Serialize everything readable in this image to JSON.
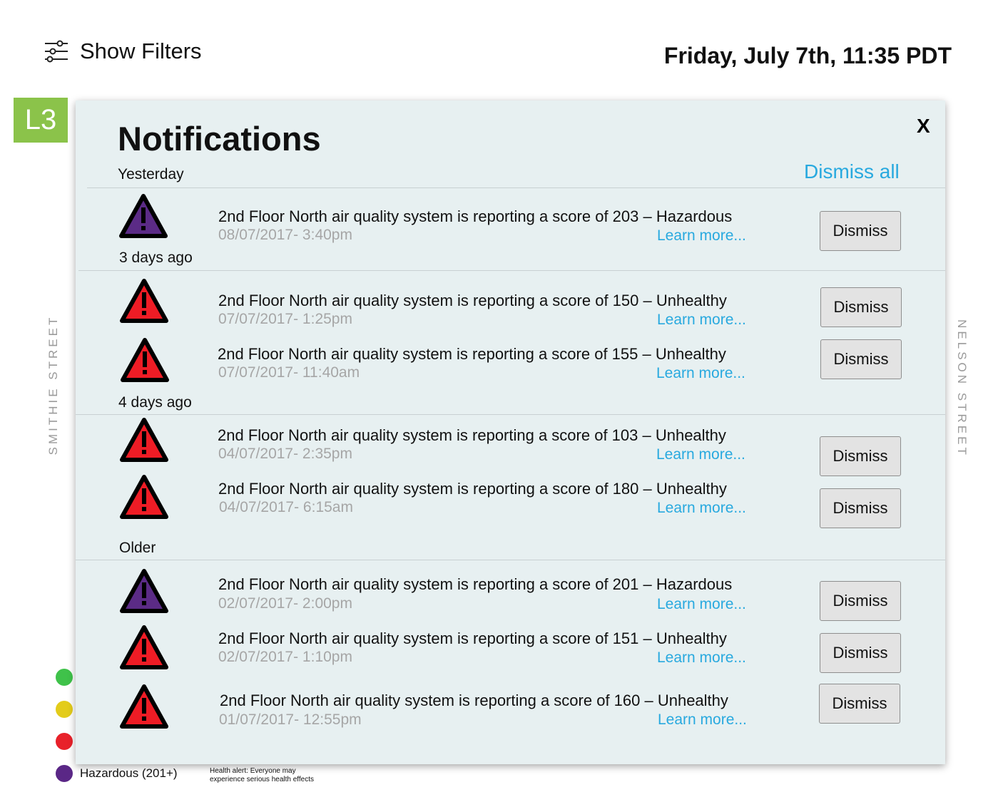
{
  "header": {
    "filters_label": "Show Filters",
    "datetime": "Friday, July 7th, 11:35 PDT"
  },
  "level_badge": "L3",
  "streets": {
    "left": "SMITHIE STREET",
    "right": "NELSON STREET"
  },
  "legend": {
    "colors": [
      "#3fc24a",
      "#e3cc1b",
      "#e8212a",
      "#5a2786"
    ],
    "hazardous_label": "Hazardous (201+)",
    "hazardous_desc": "Health alert: Everyone may experience serious health effects"
  },
  "panel": {
    "title": "Notifications",
    "close_label": "X",
    "dismiss_all_label": "Dismiss all",
    "groups": [
      "Yesterday",
      "3 days ago",
      "4 days ago",
      "Older"
    ],
    "learn_more_label": "Learn more...",
    "dismiss_label": "Dismiss",
    "colors": {
      "hazardous": "#5b2b86",
      "unhealthy": "#ee1c25",
      "link": "#28a9df"
    },
    "items": [
      {
        "message": "2nd Floor North air quality system is reporting a score of 203 – Hazardous",
        "timestamp": "08/07/2017- 3:40pm",
        "severity": "hazardous"
      },
      {
        "message": "2nd Floor North air quality system is reporting a score of 150 – Unhealthy",
        "timestamp": "07/07/2017- 1:25pm",
        "severity": "unhealthy"
      },
      {
        "message": "2nd Floor North air quality system is reporting a score of 155 – Unhealthy",
        "timestamp": "07/07/2017- 11:40am",
        "severity": "unhealthy"
      },
      {
        "message": "2nd Floor North air quality system is reporting a score of 103 – Unhealthy",
        "timestamp": "04/07/2017- 2:35pm",
        "severity": "unhealthy"
      },
      {
        "message": "2nd Floor North air quality system is reporting a score of 180 – Unhealthy",
        "timestamp": "04/07/2017- 6:15am",
        "severity": "unhealthy"
      },
      {
        "message": "2nd Floor North air quality system is reporting a score of 201 – Hazardous",
        "timestamp": "02/07/2017- 2:00pm",
        "severity": "hazardous"
      },
      {
        "message": "2nd Floor North air quality system is reporting a score of 151 – Unhealthy",
        "timestamp": "02/07/2017- 1:10pm",
        "severity": "unhealthy"
      },
      {
        "message": "2nd Floor North air quality system is reporting a score of 160 – Unhealthy",
        "timestamp": "01/07/2017- 12:55pm",
        "severity": "unhealthy"
      }
    ]
  }
}
